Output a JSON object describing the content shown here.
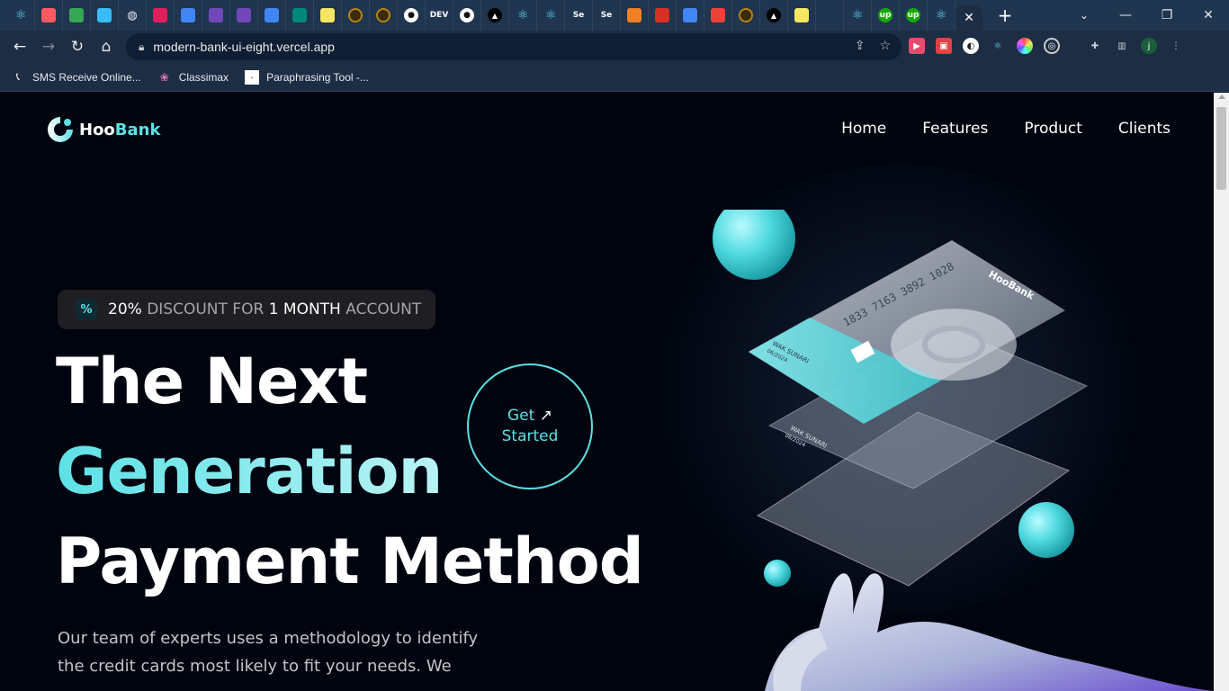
{
  "browser": {
    "url": "modern-bank-ui-eight.vercel.app",
    "tabs": [
      "react-icon",
      "airbnb-icon",
      "maps-icon",
      "tailwind-icon",
      "globe-icon",
      "slack-icon",
      "docs-icon",
      "forms-icon",
      "forms-icon",
      "docs-icon",
      "meet-icon",
      "arrow-icon",
      "coin-icon",
      "coin-icon",
      "github-icon",
      "dev-icon",
      "github-icon",
      "vercel-icon",
      "react-icon",
      "react-icon",
      "search-icon",
      "search-icon",
      "stackoverflow-icon",
      "hotel-icon",
      "photos-icon",
      "maps-pin-icon",
      "coin-icon",
      "vercel-icon",
      "arrow-icon",
      "blank-icon",
      "react-icon",
      "upwork-icon",
      "upwork-icon",
      "react-icon"
    ],
    "tab_texts": [
      "DEV",
      "Se",
      "Se",
      "up",
      "up"
    ],
    "bookmarks": [
      {
        "label": "SMS Receive Online...",
        "icon": "phone-icon"
      },
      {
        "label": "Classimax",
        "icon": "lotus-icon"
      },
      {
        "label": "Paraphrasing Tool -...",
        "icon": "doc-icon"
      }
    ],
    "profile_initial": "j"
  },
  "site": {
    "logo": {
      "prefix": "Hoo",
      "suffix": "Bank"
    },
    "nav": [
      "Home",
      "Features",
      "Product",
      "Clients"
    ],
    "discount": {
      "percent": "20%",
      "pre": "DISCOUNT FOR",
      "num": "1 MONTH",
      "post": "ACCOUNT"
    },
    "headline": [
      "The Next",
      "Generation",
      "Payment Method"
    ],
    "cta": {
      "line1": "Get",
      "line2": "Started"
    },
    "paragraph": "Our team of experts uses a methodology to identify the credit cards most likely to fit your needs. We",
    "card": {
      "number": "1833 7163 3892 1028",
      "name": "WAK SUNARI",
      "expiry": "06/2024",
      "brand": "HooBank"
    }
  },
  "colors": {
    "accent": "#5ce1e6",
    "background": "#00040f"
  }
}
